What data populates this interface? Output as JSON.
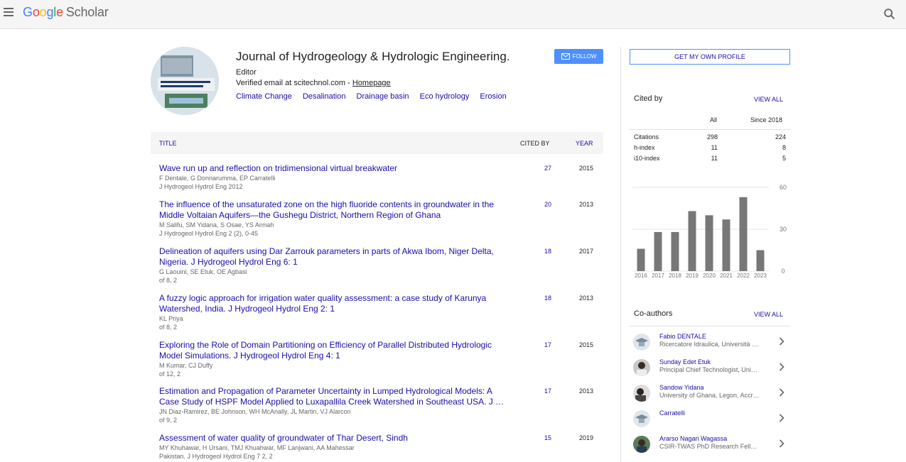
{
  "header": {
    "logo_google": [
      "G",
      "o",
      "o",
      "g",
      "l",
      "e"
    ],
    "logo_scholar": "Scholar"
  },
  "profile": {
    "name": "Journal of Hydrogeology & Hydrologic Engineering.",
    "affiliation": "Editor",
    "email_text": "Verified email at scitechnol.com - ",
    "homepage_label": "Homepage",
    "interests": [
      "Climate Change",
      "Desalination",
      "Drainage basin",
      "Eco hydrology",
      "Erosion"
    ],
    "follow_label": "FOLLOW"
  },
  "table": {
    "headers": {
      "title": "TITLE",
      "cited_by": "CITED BY",
      "year": "YEAR"
    },
    "rows": [
      {
        "title": "Wave run up and reflection on tridimensional virtual breakwater",
        "authors": "F Dentale, G Donnarumma, EP Carratelli",
        "venue": "J Hydrogeol Hydrol Eng 2012",
        "cites": "27",
        "year": "2015"
      },
      {
        "title": "The influence of the unsaturated zone on the high fluoride contents in groundwater in the Middle Voltaian Aquifers—the Gushegu District, Northern Region of Ghana",
        "authors": "M Salifu, SM Yidana, S Osae, YS Armah",
        "venue": "J Hydrogeol Hydrol Eng 2 (2), 0-45",
        "cites": "20",
        "year": "2013"
      },
      {
        "title": "Delineation of aquifers using Dar Zarrouk parameters in parts of Akwa Ibom, Niger Delta, Nigeria. J Hydrogeol Hydrol Eng 6: 1",
        "authors": "G Laouini, SE Etuk, OE Agbasi",
        "venue": "of 8, 2",
        "cites": "18",
        "year": "2017"
      },
      {
        "title": "A fuzzy logic approach for irrigation water quality assessment: a case study of Karunya Watershed, India. J Hydrogeol Hydrol Eng 2: 1",
        "authors": "KL Priya",
        "venue": "of 8, 2",
        "cites": "18",
        "year": "2013"
      },
      {
        "title": "Exploring the Role of Domain Partitioning on Efficiency of Parallel Distributed Hydrologic Model Simulations. J Hydrogeol Hydrol Eng 4: 1",
        "authors": "M Kumar, CJ Duffy",
        "venue": "of 12, 2",
        "cites": "17",
        "year": "2015"
      },
      {
        "title": "Estimation and Propagation of Parameter Uncertainty in Lumped Hydrological Models: A Case Study of HSPF Model Applied to Luxapallila Creek Watershed in Southeast USA. J …",
        "authors": "JN Diaz-Ramirez, BE Johnson, WH McAnally, JL Martin, VJ Alarcon",
        "venue": "of 9, 2",
        "cites": "17",
        "year": "2013"
      },
      {
        "title": "Assessment of water quality of groundwater of Thar Desert, Sindh",
        "authors": "MY Khuhawar, H Ursani, TMJ Khuahwar, MF Lanjwani, AA Mahessar",
        "venue": "Pakistan. J Hydrogeol Hydrol Eng 7 2, 2",
        "cites": "15",
        "year": "2019"
      }
    ]
  },
  "sidebar": {
    "own_profile_label": "GET MY OWN PROFILE",
    "cited_by_title": "Cited by",
    "view_all": "VIEW ALL",
    "col_all": "All",
    "col_since": "Since 2018",
    "metrics": [
      {
        "label": "Citations",
        "all": "298",
        "since": "224"
      },
      {
        "label": "h-index",
        "all": "11",
        "since": "8"
      },
      {
        "label": "i10-index",
        "all": "11",
        "since": "5"
      }
    ],
    "coauthors_title": "Co-authors",
    "coauthors": [
      {
        "name": "Fabio DENTALE",
        "affiliation": "Ricercatore Idraulica, Università …"
      },
      {
        "name": "Sunday Edet Etuk",
        "affiliation": "Principal Chief Technologist, Uni…"
      },
      {
        "name": "Sandow Yidana",
        "affiliation": "University of Ghana, Legon, Accr…"
      },
      {
        "name": "Carratelli",
        "affiliation": ""
      },
      {
        "name": "Ararso Nagari Wagassa",
        "affiliation": "CSIR-TWAS PhD Research Fell…"
      }
    ]
  },
  "chart_data": {
    "type": "bar",
    "categories": [
      "2016",
      "2017",
      "2018",
      "2019",
      "2020",
      "2021",
      "2022",
      "2023"
    ],
    "values": [
      16,
      28,
      28,
      43,
      40,
      37,
      53,
      15
    ],
    "ylim": [
      0,
      60
    ],
    "yticks": [
      "60",
      "30",
      "0"
    ],
    "bar_color": "#777777"
  }
}
